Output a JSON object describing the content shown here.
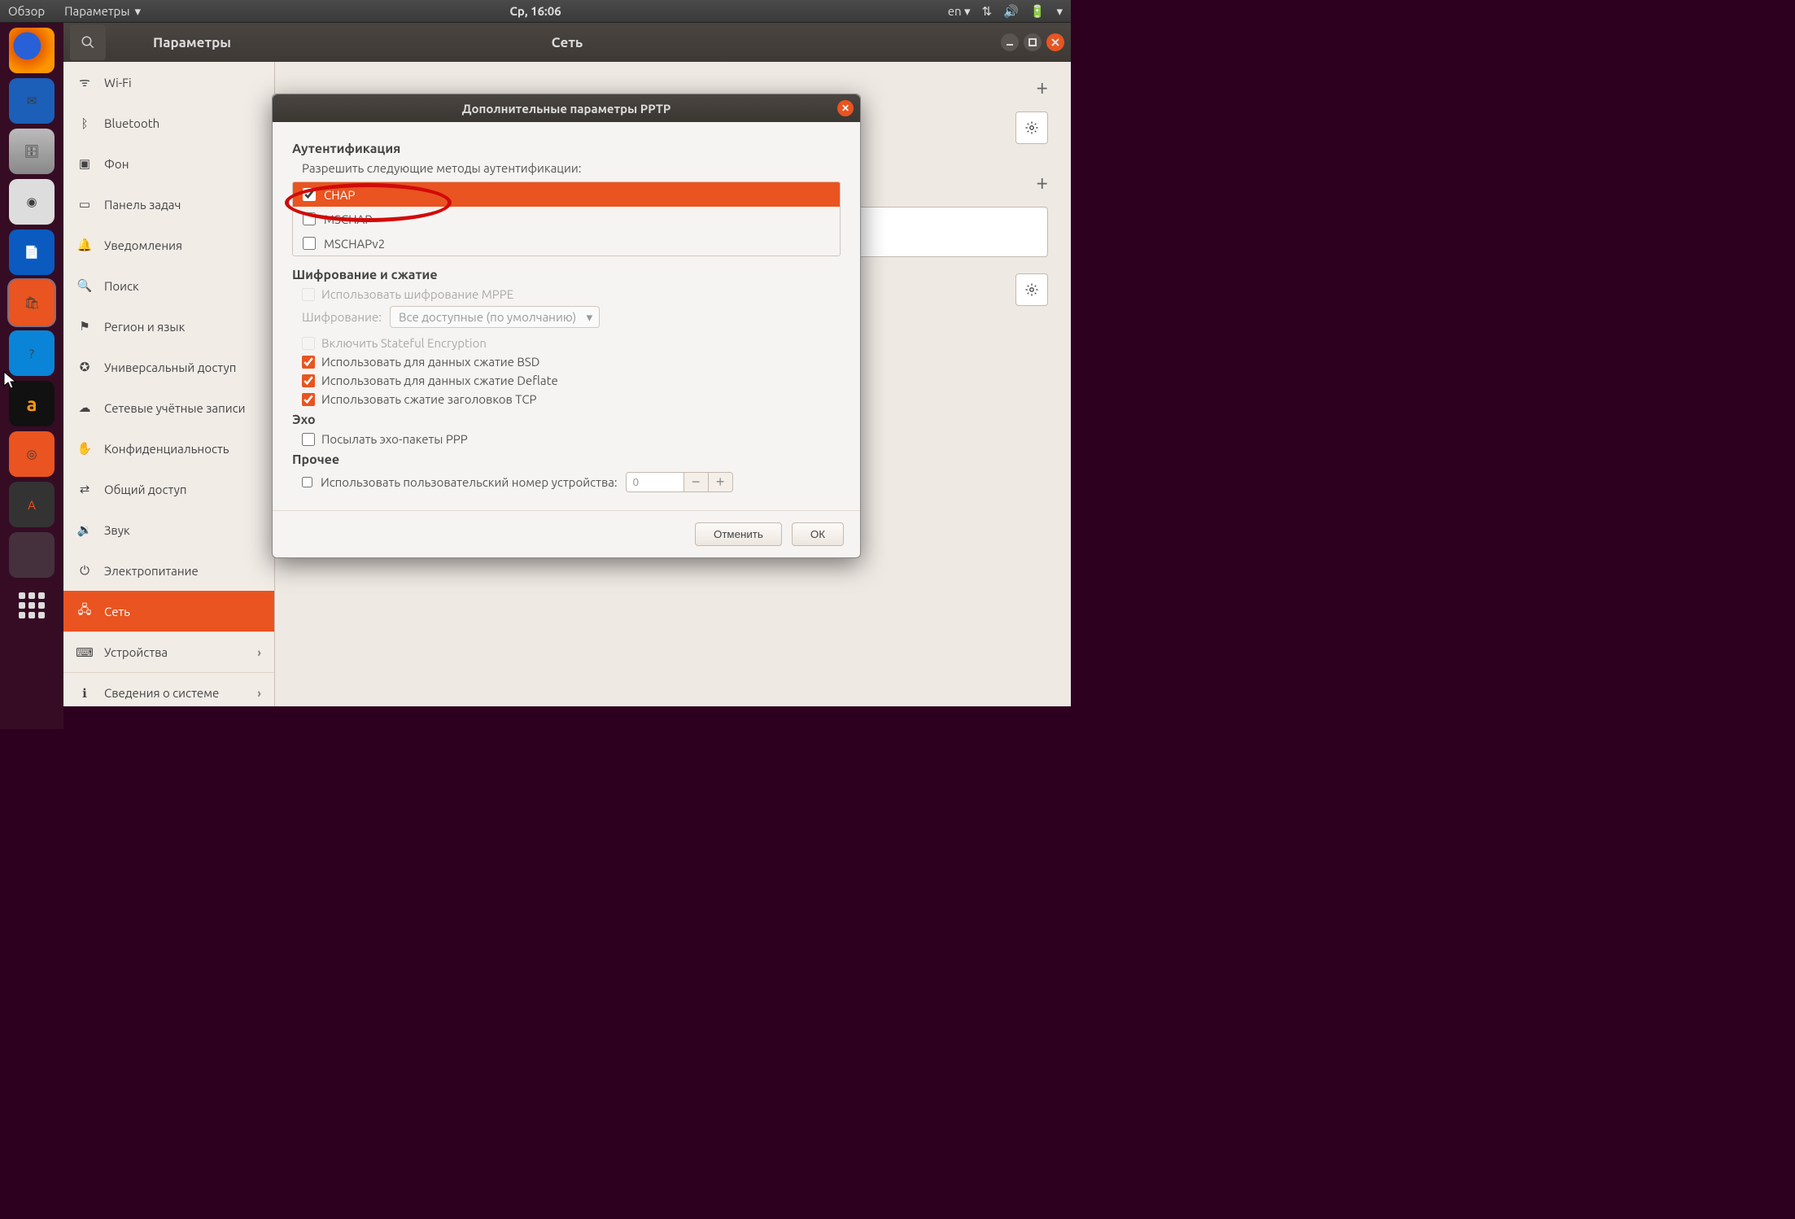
{
  "topbar": {
    "overview": "Обзор",
    "app_menu": "Параметры",
    "clock": "Ср, 16:06",
    "lang": "en"
  },
  "launcher_tooltip": "Менеджер приложений Ubuntu",
  "settings": {
    "search_aria": "Поиск",
    "title_left": "Параметры",
    "title_center": "Сеть",
    "sidebar": [
      {
        "icon": "wifi",
        "label": "Wi-Fi"
      },
      {
        "icon": "bt",
        "label": "Bluetooth"
      },
      {
        "icon": "bg",
        "label": "Фон"
      },
      {
        "icon": "dock",
        "label": "Панель задач"
      },
      {
        "icon": "bell",
        "label": "Уведомления"
      },
      {
        "icon": "search",
        "label": "Поиск"
      },
      {
        "icon": "region",
        "label": "Регион и язык"
      },
      {
        "icon": "a11y",
        "label": "Универсальный доступ"
      },
      {
        "icon": "online",
        "label": "Сетевые учётные записи"
      },
      {
        "icon": "privacy",
        "label": "Конфиденциальность"
      },
      {
        "icon": "share",
        "label": "Общий доступ"
      },
      {
        "icon": "sound",
        "label": "Звук"
      },
      {
        "icon": "power",
        "label": "Электропитание"
      },
      {
        "icon": "net",
        "label": "Сеть",
        "active": true
      },
      {
        "icon": "dev",
        "label": "Устройства",
        "chev": true,
        "border": true
      },
      {
        "icon": "info",
        "label": "Сведения о системе",
        "chev": true,
        "border": true
      }
    ]
  },
  "dialog": {
    "title": "Дополнительные параметры PPTP",
    "auth_title": "Аутентификация",
    "auth_sub": "Разрешить следующие методы аутентификации:",
    "auth_methods": [
      {
        "label": "CHAP",
        "checked": true,
        "selected": true
      },
      {
        "label": "MSCHAP",
        "checked": false
      },
      {
        "label": "MSCHAPv2",
        "checked": false
      }
    ],
    "enc_title": "Шифрование и сжатие",
    "mppe_label": "Использовать шифрование MPPE",
    "enc_label": "Шифрование:",
    "enc_value": "Все доступные (по умолчанию)",
    "stateful_label": "Включить Stateful Encryption",
    "bsd_label": "Использовать для данных сжатие BSD",
    "deflate_label": "Использовать для данных сжатие Deflate",
    "tcp_label": "Использовать сжатие заголовков TCP",
    "echo_title": "Эхо",
    "echo_label": "Посылать эхо-пакеты PPP",
    "other_title": "Прочее",
    "unit_label": "Использовать пользовательский номер устройства:",
    "unit_value": "0",
    "cancel": "Отменить",
    "ok": "ОК"
  }
}
